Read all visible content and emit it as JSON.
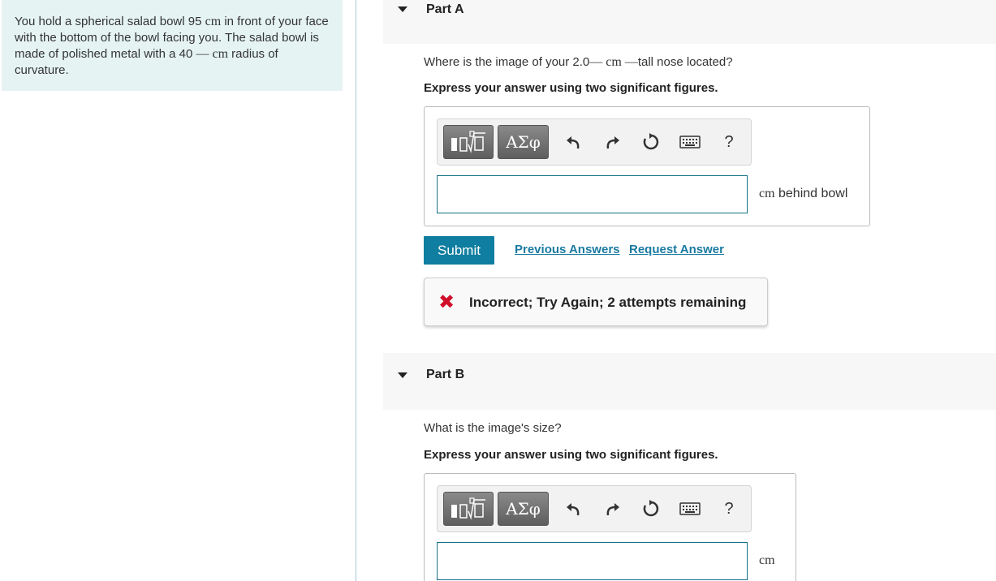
{
  "problem": {
    "text_1": "You hold a spherical salad bowl 95 ",
    "unit_1": "cm",
    "text_2": " in front of your face with the bottom of the bowl facing you. The salad bowl is made of polished metal with a 40 ",
    "unit_2": "— cm",
    "text_3": " radius of curvature."
  },
  "toolbar": {
    "templates_icon": "sqrt-template-icon",
    "symbols_label": "ΑΣφ",
    "undo_icon": "undo-icon",
    "redo_icon": "redo-icon",
    "reset_icon": "reset-icon",
    "keyboard_icon": "keyboard-icon",
    "help_label": "?"
  },
  "part_a": {
    "title": "Part A",
    "question_1": "Where is the image of your 2.0",
    "question_unit": "— cm —",
    "question_2": "tall nose located?",
    "instruction": "Express your answer using two significant figures.",
    "input_value": "",
    "unit_serif": "cm",
    "unit_text": " behind bowl",
    "submit_label": "Submit",
    "previous_answers_label": "Previous Answers",
    "request_answer_label": "Request Answer",
    "feedback_icon": "incorrect-x-icon",
    "feedback_text": "Incorrect; Try Again; 2 attempts remaining"
  },
  "part_b": {
    "title": "Part B",
    "question": "What is the image's size?",
    "instruction": "Express your answer using two significant figures.",
    "input_value": "",
    "unit": "cm"
  },
  "colors": {
    "problem_bg": "#e5f4f3",
    "submit_bg": "#0f7ea0",
    "link": "#1a7aa1",
    "incorrect": "#d0102a"
  }
}
